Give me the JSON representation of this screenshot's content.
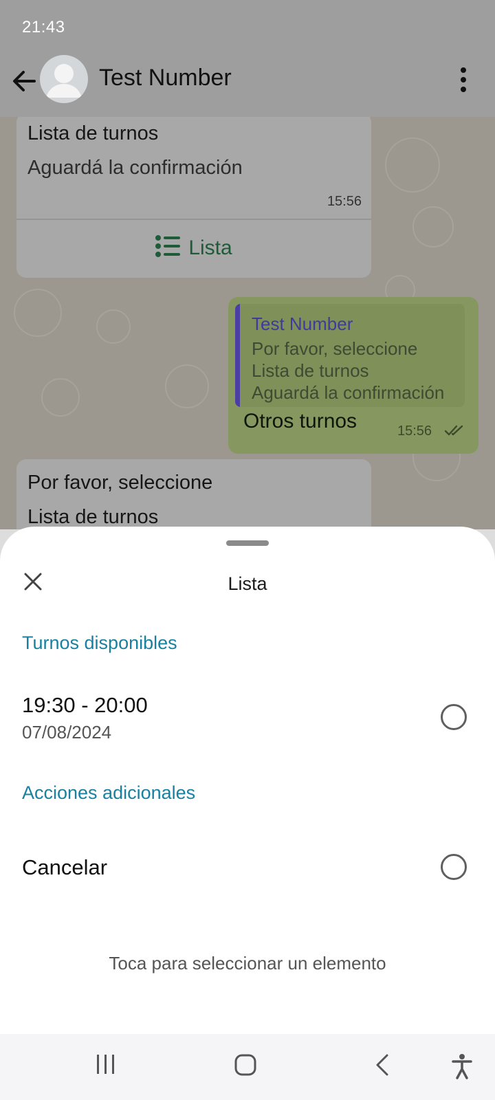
{
  "status": {
    "time": "21:43"
  },
  "header": {
    "contact_name": "Test Number"
  },
  "messages": {
    "top_bubble": {
      "line1": "Lista de turnos",
      "line2": "Aguardá la confirmación",
      "time": "15:56",
      "button_label": "Lista"
    },
    "sent_bubble": {
      "quote_name": "Test Number",
      "quote_lines": [
        "Por favor, seleccione",
        "Lista de turnos",
        "Aguardá la confirmación"
      ],
      "text": "Otros turnos",
      "time": "15:56"
    },
    "bottom_bubble": {
      "line1": "Por favor, seleccione",
      "line2": "Lista de turnos"
    }
  },
  "sheet": {
    "title": "Lista",
    "sections": [
      {
        "title": "Turnos disponibles",
        "options": [
          {
            "title": "19:30 - 20:00",
            "subtitle": "07/08/2024",
            "selected": false
          }
        ]
      },
      {
        "title": "Acciones adicionales",
        "options": [
          {
            "title": "Cancelar",
            "selected": false
          }
        ]
      }
    ],
    "hint": "Toca para seleccionar un elemento"
  },
  "colors": {
    "section_title": "#1a80a0",
    "list_button": "#1e5c39",
    "quote_bar": "#4b3fa3"
  }
}
